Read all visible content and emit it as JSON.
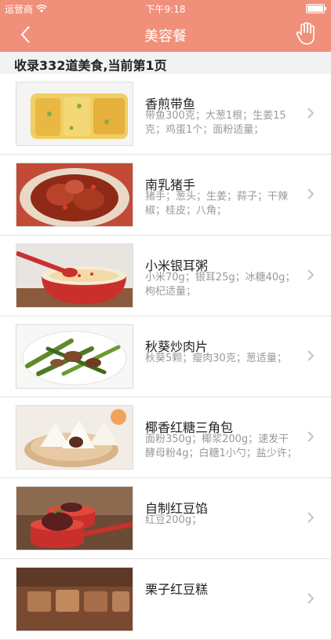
{
  "status": {
    "carrier": "运营商",
    "time": "下午9:18"
  },
  "nav": {
    "title": "美容餐"
  },
  "summary": "收录332道美食,当前第1页",
  "items": [
    {
      "name": "香煎带鱼",
      "desc": "带鱼300克；大葱1根；生姜15克；鸡蛋1个；面粉适量；"
    },
    {
      "name": "南乳猪手",
      "desc": "猪手；葱头；生姜；蒜子；干辣椒；桂皮；八角；"
    },
    {
      "name": "小米银耳粥",
      "desc": "小米70g；银耳25g；冰糖40g；枸杞适量；"
    },
    {
      "name": "秋葵炒肉片",
      "desc": "秋葵5颗；瘦肉30克；葱适量；"
    },
    {
      "name": "椰香红糖三角包",
      "desc": "面粉350g；椰浆200g；速发干酵母粉4g；白糖1小勺；盐少许；"
    },
    {
      "name": "自制红豆馅",
      "desc": "红豆200g；"
    },
    {
      "name": "栗子红豆糕",
      "desc": ""
    }
  ]
}
